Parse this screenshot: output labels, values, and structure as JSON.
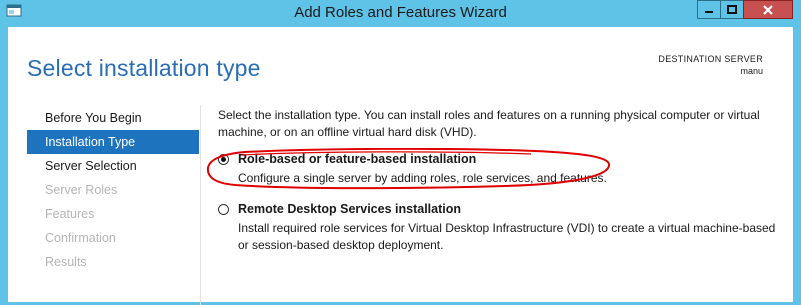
{
  "window": {
    "title": "Add Roles and Features Wizard"
  },
  "header": {
    "page_title": "Select installation type",
    "destination_label": "DESTINATION SERVER",
    "destination_value": "manu"
  },
  "steps": [
    {
      "label": "Before You Begin",
      "state": "normal"
    },
    {
      "label": "Installation Type",
      "state": "active"
    },
    {
      "label": "Server Selection",
      "state": "normal"
    },
    {
      "label": "Server Roles",
      "state": "disabled"
    },
    {
      "label": "Features",
      "state": "disabled"
    },
    {
      "label": "Confirmation",
      "state": "disabled"
    },
    {
      "label": "Results",
      "state": "disabled"
    }
  ],
  "content": {
    "intro": "Select the installation type. You can install roles and features on a running physical computer or virtual machine, or on an offline virtual hard disk (VHD).",
    "options": [
      {
        "label": "Role-based or feature-based installation",
        "description": "Configure a single server by adding roles, role services, and features.",
        "selected": true
      },
      {
        "label": "Remote Desktop Services installation",
        "description": "Install required role services for Virtual Desktop Infrastructure (VDI) to create a virtual machine-based or session-based desktop deployment.",
        "selected": false
      }
    ]
  },
  "colors": {
    "title_bar": "#5fc3e8",
    "active_step": "#1e73be",
    "page_title": "#2a6db5",
    "annotation": "#e00000"
  }
}
